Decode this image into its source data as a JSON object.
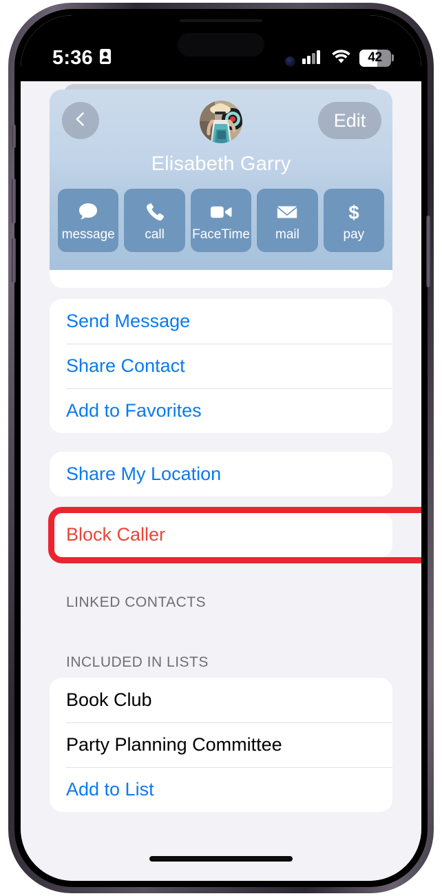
{
  "status_bar": {
    "time": "5:36",
    "time_icon": "id-card-icon",
    "cellular_icon": "cellular-bars-icon",
    "wifi_icon": "wifi-icon",
    "battery_level": "42",
    "battery_percent": 42
  },
  "header": {
    "back_icon": "chevron-left-icon",
    "edit_label": "Edit",
    "contact_name": "Elisabeth Garry",
    "avatar_name": "contact-avatar",
    "background_color": "#b9cee3"
  },
  "actions": [
    {
      "label": "message",
      "icon": "message-bubble-icon"
    },
    {
      "label": "call",
      "icon": "phone-handset-icon"
    },
    {
      "label": "FaceTime",
      "icon": "video-camera-icon"
    },
    {
      "label": "mail",
      "icon": "envelope-icon"
    },
    {
      "label": "pay",
      "icon": "dollar-sign-icon"
    }
  ],
  "groups": {
    "actions": [
      {
        "label": "Send Message",
        "style": "blue"
      },
      {
        "label": "Share Contact",
        "style": "blue"
      },
      {
        "label": "Add to Favorites",
        "style": "blue"
      }
    ],
    "location": [
      {
        "label": "Share My Location",
        "style": "blue"
      }
    ],
    "block": [
      {
        "label": "Block Caller",
        "style": "red"
      }
    ],
    "lists": [
      {
        "label": "Book Club",
        "style": "black"
      },
      {
        "label": "Party Planning Committee",
        "style": "black"
      },
      {
        "label": "Add to List",
        "style": "blue"
      }
    ]
  },
  "section_headers": {
    "linked_contacts": "LINKED CONTACTS",
    "included_in_lists": "INCLUDED IN LISTS"
  },
  "annotation": {
    "target": "Block Caller",
    "color": "#ec2430"
  },
  "colors": {
    "ios_blue": "#0b7aef",
    "ios_red": "#ec4439",
    "action_button": "#6f97bd",
    "page_background": "#f2f2f7"
  }
}
